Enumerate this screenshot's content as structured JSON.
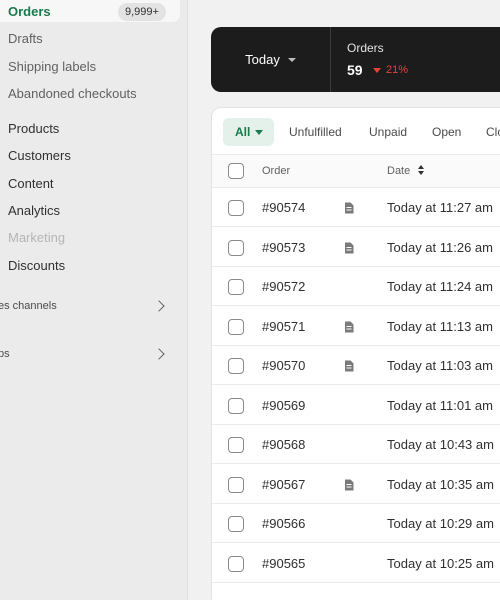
{
  "sidebar": {
    "orders_label": "Orders",
    "orders_badge": "9,999+",
    "sub_items": [
      "Drafts",
      "Shipping labels",
      "Abandoned checkouts"
    ],
    "main_items": [
      "Products",
      "Customers",
      "Content",
      "Analytics",
      "Marketing",
      "Discounts"
    ],
    "sections": [
      "es channels",
      "ps"
    ]
  },
  "stats": {
    "period_label": "Today",
    "metric_label": "Orders",
    "metric_value": "59",
    "metric_delta": "21%",
    "accent_color": "#1a7a4c",
    "negative_color": "#e0453a"
  },
  "orders_table": {
    "tabs": [
      "All",
      "Unfulfilled",
      "Unpaid",
      "Open",
      "Clo"
    ],
    "columns": {
      "order": "Order",
      "date": "Date"
    },
    "rows": [
      {
        "order": "#90574",
        "has_note": true,
        "date": "Today at 11:27 am"
      },
      {
        "order": "#90573",
        "has_note": true,
        "date": "Today at 11:26 am"
      },
      {
        "order": "#90572",
        "has_note": false,
        "date": "Today at 11:24 am"
      },
      {
        "order": "#90571",
        "has_note": true,
        "date": "Today at 11:13 am"
      },
      {
        "order": "#90570",
        "has_note": true,
        "date": "Today at 11:03 am"
      },
      {
        "order": "#90569",
        "has_note": false,
        "date": "Today at 11:01 am"
      },
      {
        "order": "#90568",
        "has_note": false,
        "date": "Today at 10:43 am"
      },
      {
        "order": "#90567",
        "has_note": true,
        "date": "Today at 10:35 am"
      },
      {
        "order": "#90566",
        "has_note": false,
        "date": "Today at 10:29 am"
      },
      {
        "order": "#90565",
        "has_note": false,
        "date": "Today at 10:25 am"
      }
    ]
  }
}
